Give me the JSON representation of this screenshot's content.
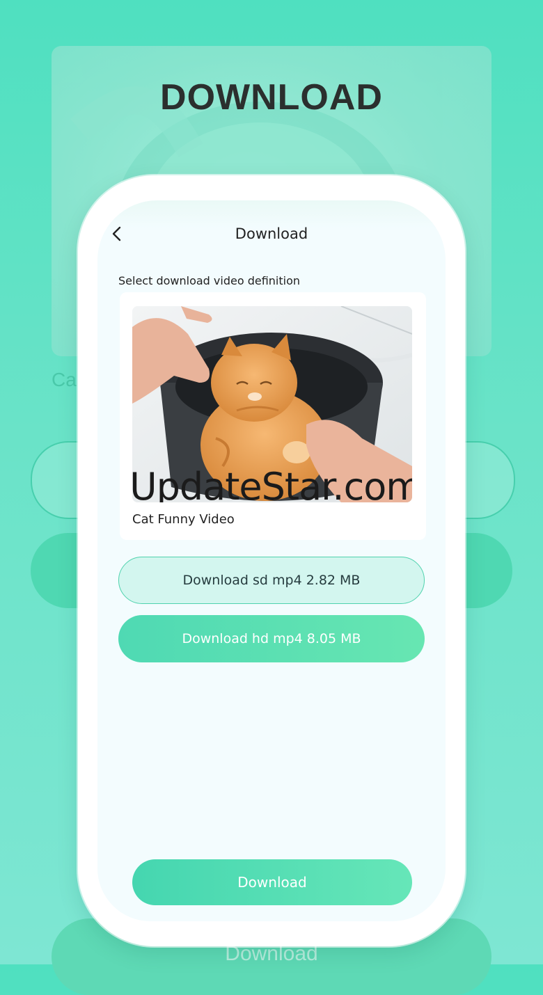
{
  "heading": "DOWNLOAD",
  "background": {
    "caption_fragment": "Ca",
    "bottom_button_label": "Download"
  },
  "header": {
    "back_icon": "chevron-left-icon",
    "title": "Download"
  },
  "section_label": "Select download video definition",
  "video": {
    "title": "Cat Funny Video",
    "watermark": "UpdateStar.com"
  },
  "options": [
    {
      "label": "Download sd mp4 2.82 MB",
      "selected": false
    },
    {
      "label": "Download hd mp4 8.05 MB",
      "selected": true
    }
  ],
  "download_button": "Download",
  "colors": {
    "accent": "#4fd9b3",
    "accent_light": "#d3f6ef",
    "screen_bg": "#f3fcfe"
  }
}
